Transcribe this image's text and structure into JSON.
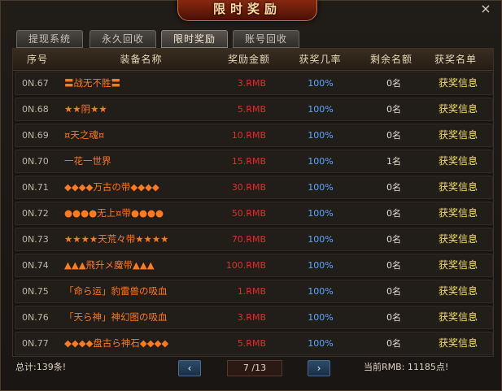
{
  "title": "限时奖励",
  "close_icon": "×",
  "tabs": [
    {
      "label": "提现系统",
      "active": false
    },
    {
      "label": "永久回收",
      "active": false
    },
    {
      "label": "限时奖励",
      "active": true
    },
    {
      "label": "账号回收",
      "active": false
    }
  ],
  "columns": [
    "序号",
    "装备名称",
    "奖励金额",
    "获奖几率",
    "剩余名额",
    "获奖名单"
  ],
  "rows": [
    {
      "no": "0N.67",
      "name": "〓战无不胜〓",
      "amount": "3.RMB",
      "rate": "100%",
      "remaining": "0名",
      "link": "获奖信息"
    },
    {
      "no": "0N.68",
      "name": "★★阴★★",
      "amount": "5.RMB",
      "rate": "100%",
      "remaining": "0名",
      "link": "获奖信息"
    },
    {
      "no": "0N.69",
      "name": "¤天之魂¤",
      "amount": "10.RMB",
      "rate": "100%",
      "remaining": "0名",
      "link": "获奖信息"
    },
    {
      "no": "0N.70",
      "name": "一花一世界",
      "amount": "15.RMB",
      "rate": "100%",
      "remaining": "1名",
      "link": "获奖信息"
    },
    {
      "no": "0N.71",
      "name": "◆◆◆◆万古の带◆◆◆◆",
      "amount": "30.RMB",
      "rate": "100%",
      "remaining": "0名",
      "link": "获奖信息"
    },
    {
      "no": "0N.72",
      "name": "●●●●无上¤带●●●●",
      "amount": "50.RMB",
      "rate": "100%",
      "remaining": "0名",
      "link": "获奖信息"
    },
    {
      "no": "0N.73",
      "name": "★★★★天荒々带★★★★",
      "amount": "70.RMB",
      "rate": "100%",
      "remaining": "0名",
      "link": "获奖信息"
    },
    {
      "no": "0N.74",
      "name": "▲▲▲飛升メ魔带▲▲▲",
      "amount": "100.RMB",
      "rate": "100%",
      "remaining": "0名",
      "link": "获奖信息"
    },
    {
      "no": "0N.75",
      "name": "「命ら运」豹雷兽の吸血",
      "amount": "1.RMB",
      "rate": "100%",
      "remaining": "0名",
      "link": "获奖信息"
    },
    {
      "no": "0N.76",
      "name": "「天ら神」神幻图の吸血",
      "amount": "3.RMB",
      "rate": "100%",
      "remaining": "0名",
      "link": "获奖信息"
    },
    {
      "no": "0N.77",
      "name": "◆◆◆◆盘古ら神石◆◆◆◆",
      "amount": "5.RMB",
      "rate": "100%",
      "remaining": "0名",
      "link": "获奖信息"
    }
  ],
  "footer": {
    "total": "总计:139条!",
    "prev_icon": "chevron-left",
    "next_icon": "chevron-right",
    "page": "7 /13",
    "balance": "当前RMB: 11185点!"
  }
}
